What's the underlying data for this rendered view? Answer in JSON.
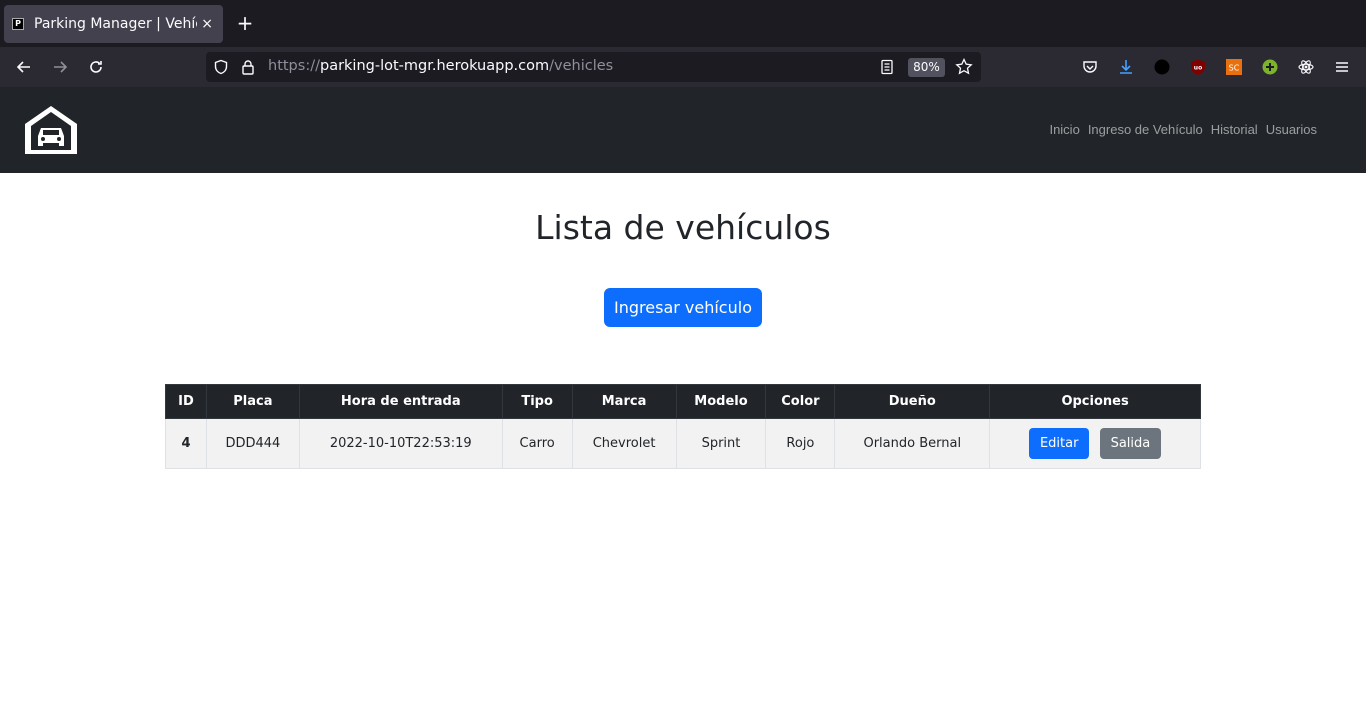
{
  "browser": {
    "tab_title": "Parking Manager | Vehículos",
    "tab_favicon": "P",
    "tab_close": "×",
    "new_tab": "+",
    "url_scheme": "https://",
    "url_host": "parking-lot-mgr.herokuapp.com",
    "url_path": "/vehicles",
    "zoom": "80%",
    "icons": [
      "back-arrow-icon",
      "forward-arrow-icon",
      "reload-icon",
      "shield-icon",
      "lock-icon",
      "reader-view-icon",
      "bookmark-star-icon",
      "pocket-icon",
      "download-icon",
      "extension-black-circle-icon",
      "ublock-icon",
      "sc-extension-icon",
      "plus-extension-icon",
      "react-devtools-icon",
      "hamburger-menu-icon"
    ]
  },
  "site": {
    "logo_icon": "garage-car-icon",
    "nav": [
      "Inicio",
      "Ingreso de Vehículo",
      "Historial",
      "Usuarios"
    ]
  },
  "main": {
    "title": "Lista de vehículos",
    "add_button": "Ingresar vehículo"
  },
  "table": {
    "headers": [
      "ID",
      "Placa",
      "Hora de entrada",
      "Tipo",
      "Marca",
      "Modelo",
      "Color",
      "Dueño",
      "Opciones"
    ],
    "rows": [
      {
        "id": "4",
        "placa": "DDD444",
        "hora": "2022-10-10T22:53:19",
        "tipo": "Carro",
        "marca": "Chevrolet",
        "modelo": "Sprint",
        "color": "Rojo",
        "dueno": "Orlando Bernal",
        "edit_label": "Editar",
        "exit_label": "Salida"
      }
    ]
  },
  "colors": {
    "primary": "#0d6efd",
    "secondary": "#6c757d",
    "dark": "#212529"
  }
}
